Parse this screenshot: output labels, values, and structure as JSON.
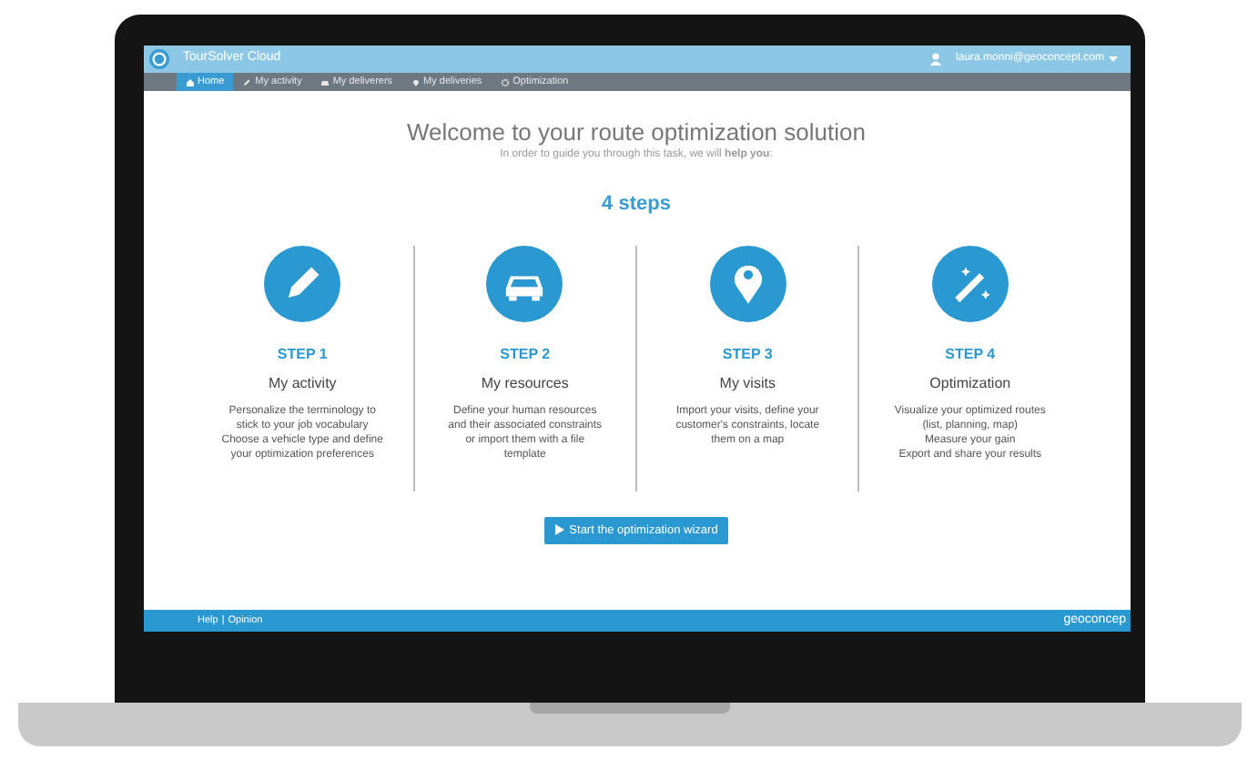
{
  "app": {
    "title": "TourSolver Cloud",
    "user": "laura.monni@geoconcept.com"
  },
  "nav": [
    {
      "label": "Home",
      "kind": "home",
      "selected": true
    },
    {
      "label": "My activity",
      "kind": "activity",
      "selected": false
    },
    {
      "label": "My deliverers",
      "kind": "deliverers",
      "selected": false
    },
    {
      "label": "My deliveries",
      "kind": "deliveries",
      "selected": false
    },
    {
      "label": "Optimization",
      "kind": "optimization",
      "selected": false
    }
  ],
  "welcome": {
    "title": "Welcome to your route optimization solution",
    "subtitle": "In order to guide you through this task, we will **help you**:",
    "count": "4 steps"
  },
  "steps": [
    {
      "kind": "activity",
      "step": "STEP 1",
      "title": "My activity",
      "lines": [
        "Personalize the terminology to",
        "stick to your job vocabulary",
        "Choose a vehicle type and define",
        "your optimization preferences"
      ]
    },
    {
      "kind": "deliverers",
      "step": "STEP 2",
      "title": "My resources",
      "lines": [
        "Define your human resources",
        "and their associated constraints",
        "or import them with a file",
        "template"
      ]
    },
    {
      "kind": "deliveries",
      "step": "STEP 3",
      "title": "My visits",
      "lines": [
        "Import your visits, define your",
        "customer's constraints, locate",
        "them on a map"
      ]
    },
    {
      "kind": "result",
      "step": "STEP 4",
      "title": "Optimization",
      "lines": [
        "Visualize your optimized routes",
        "(list, planning, map)",
        "Measure your gain",
        "Export and share your results"
      ]
    }
  ],
  "wizard_button": "Start the optimization wizard",
  "footer": {
    "links": [
      "Help",
      "Opinion"
    ],
    "separator": "|",
    "brand": "geoconcep"
  }
}
